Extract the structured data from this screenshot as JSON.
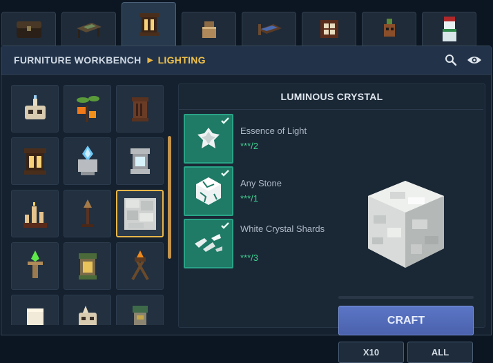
{
  "tabs": [
    {
      "icon": "chest-icon"
    },
    {
      "icon": "table-icon"
    },
    {
      "icon": "lantern-icon",
      "active": true
    },
    {
      "icon": "pottery-icon"
    },
    {
      "icon": "bed-icon"
    },
    {
      "icon": "crate-icon"
    },
    {
      "icon": "plant-creature-icon"
    },
    {
      "icon": "snowman-icon"
    }
  ],
  "header": {
    "workbench": "FURNITURE WORKBENCH",
    "category": "LIGHTING",
    "search_icon": "search-icon",
    "view_icon": "eye-icon"
  },
  "grid": {
    "items": [
      {
        "icon": "skull-candle-icon"
      },
      {
        "icon": "orange-lantern-plant-icon"
      },
      {
        "icon": "wooden-lantern-icon"
      },
      {
        "icon": "lantern-icon"
      },
      {
        "icon": "blue-crystal-lamp-icon"
      },
      {
        "icon": "stone-lantern-icon"
      },
      {
        "icon": "candles-icon"
      },
      {
        "icon": "torch-stand-icon"
      },
      {
        "icon": "luminous-crystal-icon",
        "selected": true
      },
      {
        "icon": "green-flame-torch-icon"
      },
      {
        "icon": "green-lantern-icon"
      },
      {
        "icon": "brazier-icon"
      },
      {
        "icon": "white-block-lamp-icon"
      },
      {
        "icon": "bone-lamp-icon"
      },
      {
        "icon": "stone-totem-icon"
      }
    ]
  },
  "detail": {
    "title": "LUMINOUS CRYSTAL",
    "ingredients": [
      {
        "name": "Essence of Light",
        "qty": "***/2",
        "icon": "essence-of-light-icon"
      },
      {
        "name": "Any Stone",
        "qty": "***/1",
        "icon": "stone-icon"
      },
      {
        "name": "White Crystal Shards",
        "qty": "***/3",
        "icon": "crystal-shards-icon"
      }
    ],
    "craft_label": "CRAFT",
    "x10_label": "X10",
    "all_label": "ALL"
  },
  "colors": {
    "accent": "#f0c14a",
    "ingredient_bg": "#1f7a66",
    "craft_button": "#5b76c6",
    "quantity": "#3fcf90"
  }
}
